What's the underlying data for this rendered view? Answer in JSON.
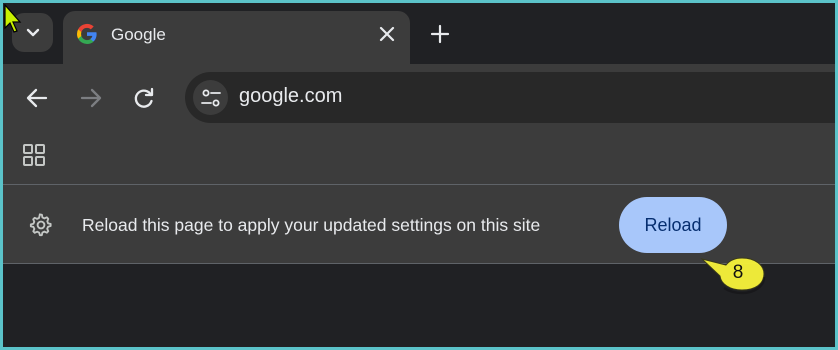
{
  "browser": {
    "tab": {
      "title": "Google"
    },
    "address_bar": {
      "url": "google.com"
    }
  },
  "infobar": {
    "message": "Reload this page to apply your updated settings on this site",
    "reload_label": "Reload"
  },
  "annotation": {
    "step_number": "8"
  },
  "icons": [
    "tab-search-chevron-icon",
    "google-favicon-icon",
    "close-icon",
    "plus-icon",
    "back-arrow-icon",
    "forward-arrow-icon",
    "reload-icon",
    "site-settings-icon",
    "apps-grid-icon",
    "gear-icon",
    "mouse-cursor-icon"
  ],
  "colors": {
    "accent_button": "#a8c7fa",
    "callout": "#f4f03a",
    "frame": "#5bc3c9"
  }
}
